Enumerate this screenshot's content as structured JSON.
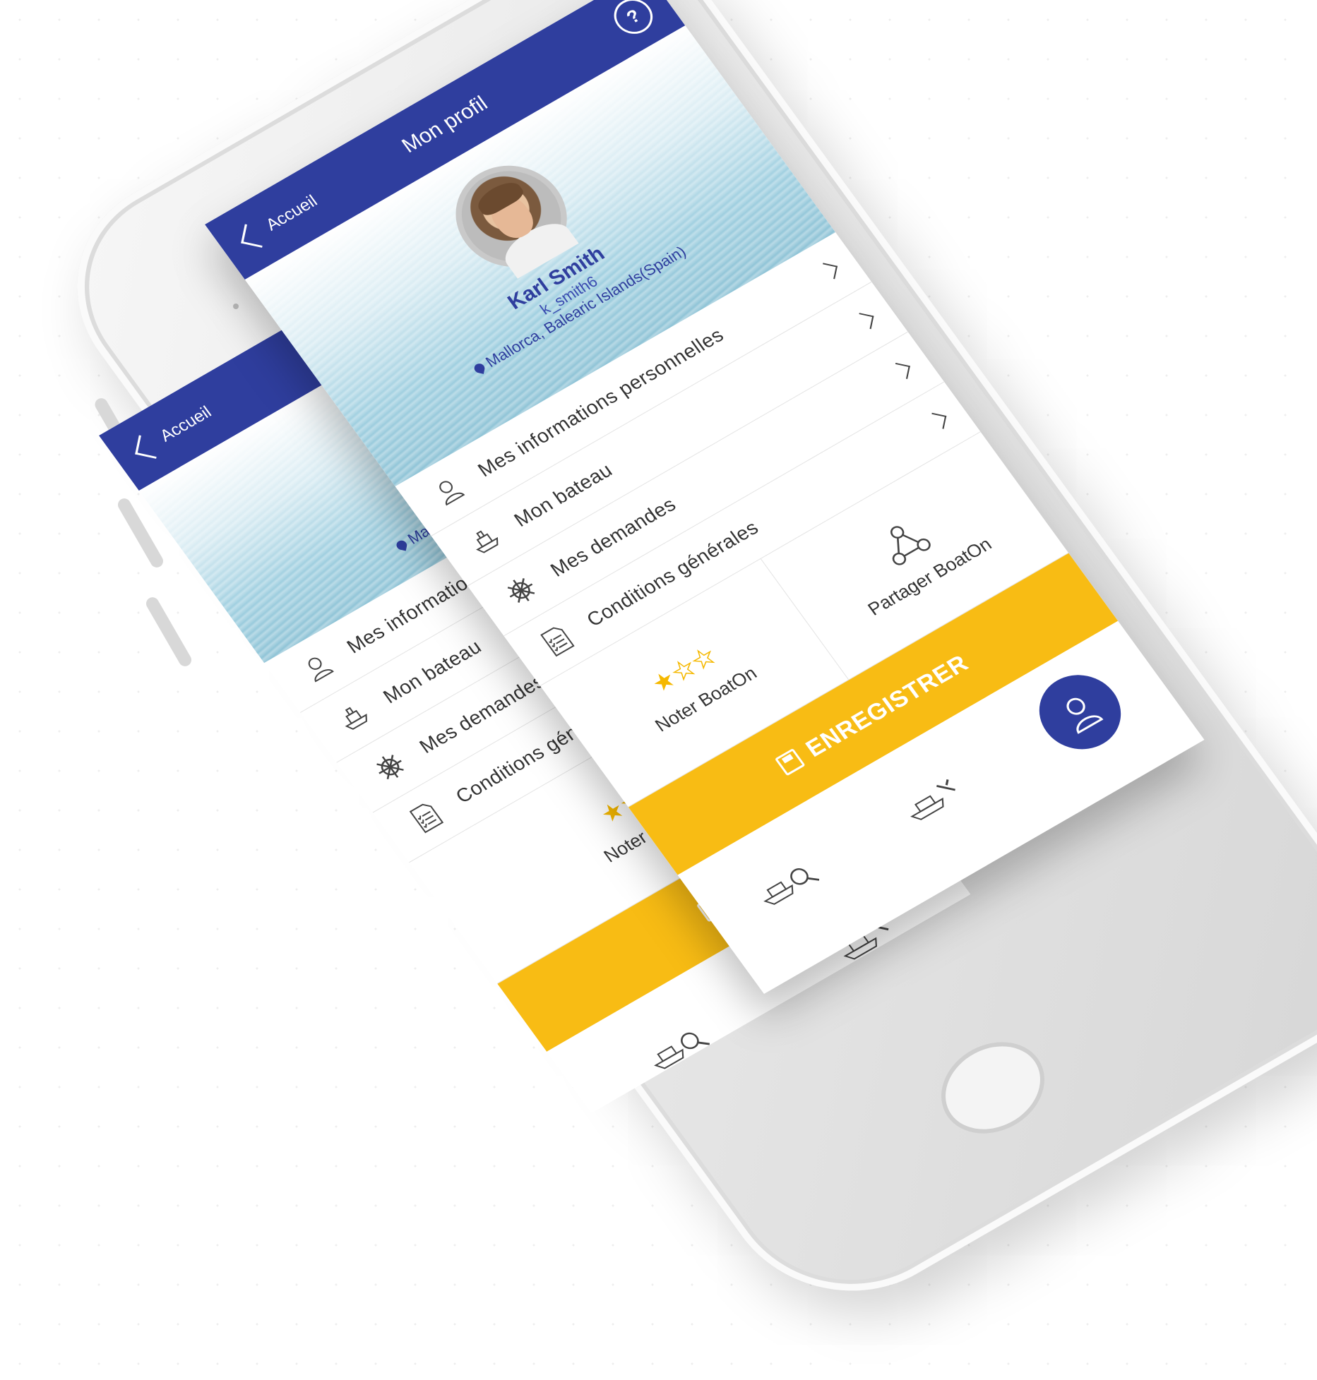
{
  "colors": {
    "primary": "#2f3e9e",
    "accent": "#f8bc14"
  },
  "topbar": {
    "back_label": "Accueil",
    "title": "Mon profil",
    "help_icon": "?"
  },
  "profile": {
    "name": "Karl Smith",
    "handle": "k_smith6",
    "location": "Mallorca, Balearic Islands(Spain)"
  },
  "back_screen": {
    "location_partial": "Mallorc"
  },
  "menu": {
    "items": [
      {
        "label": "Mes informations personnelles",
        "icon": "user-outline-icon"
      },
      {
        "label": "Mon bateau",
        "icon": "ship-icon"
      },
      {
        "label": "Mes demandes",
        "icon": "ship-wheel-icon"
      },
      {
        "label": "Conditions générales",
        "icon": "document-checklist-icon"
      }
    ],
    "back_labels": [
      "Mes informatio",
      "Mon bateau",
      "Mes demandes",
      "Conditions géné"
    ]
  },
  "tiles": {
    "rate_label": "Noter BoatOn",
    "rating": 1,
    "rating_max": 3,
    "share_label": "Partager BoatOn"
  },
  "save": {
    "label": "ENREGISTRER"
  },
  "tabbar": {
    "items": [
      "boat-search-icon",
      "boat-repair-icon",
      "profile-icon"
    ]
  }
}
